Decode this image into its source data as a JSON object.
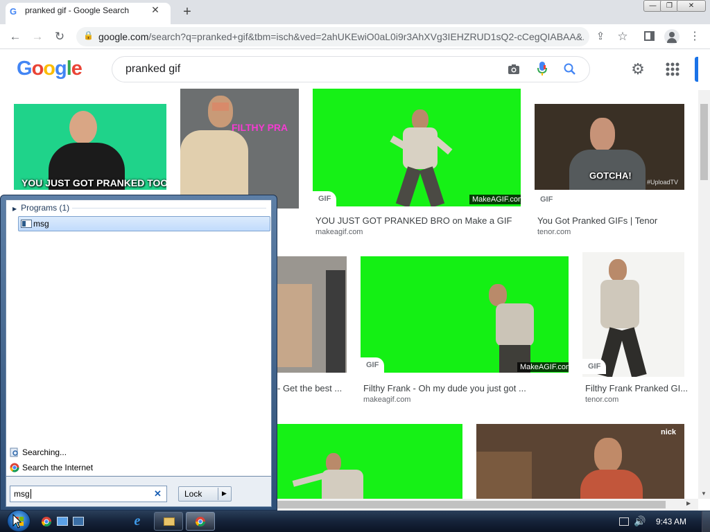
{
  "browser": {
    "tab_title": "pranked gif - Google Search",
    "tab_close": "✕",
    "new_tab": "+",
    "url_domain": "google.com",
    "url_path": "/search?q=pranked+gif&tbm=isch&ved=2ahUKEwiO0aL0i9r3AhXVg3IEHZRUD1sQ2-cCegQIABAA&...",
    "window_buttons": [
      "—",
      "❐",
      "✕"
    ]
  },
  "google": {
    "logo": [
      "G",
      "o",
      "o",
      "g",
      "l",
      "e"
    ],
    "query": "pranked gif"
  },
  "results": [
    {
      "caption": "YOU JUST GOT PRANKED TOO!"
    },
    {
      "caption": "FILTHY PRA"
    },
    {
      "badge": "GIF",
      "watermark": "MakeAGIF.com",
      "title": "YOU JUST GOT PRANKED BRO on Make a GIF",
      "source": "makeagif.com"
    },
    {
      "caption": "GOTCHA!",
      "watermark": "#UploadTV",
      "badge": "GIF",
      "title": "You Got Pranked GIFs | Tenor",
      "source": "tenor.com"
    },
    {
      "title": "- Get the best ..."
    },
    {
      "badge": "GIF",
      "watermark": "MakeAGIF.com",
      "title": "Filthy Frank - Oh my dude you just got ...",
      "source": "makeagif.com"
    },
    {
      "badge": "GIF",
      "title": "Filthy Frank Pranked GI...",
      "source": "tenor.com"
    },
    {},
    {
      "watermark": "nick"
    }
  ],
  "start_menu": {
    "programs_header": "Programs (1)",
    "program_item": "msg",
    "searching": "Searching...",
    "search_internet": "Search the Internet",
    "search_value": "msg",
    "clear": "✕",
    "lock_label": "Lock",
    "lock_arrow": "▶"
  },
  "taskbar": {
    "time": "9:43 AM"
  }
}
